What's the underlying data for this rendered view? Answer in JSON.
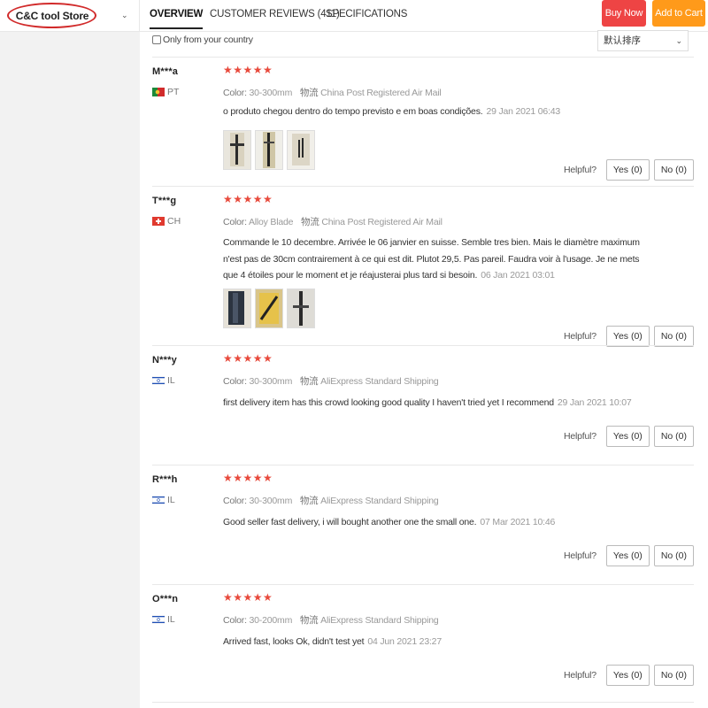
{
  "header": {
    "store_name": "C&C tool Store",
    "tabs": [
      {
        "label": "OVERVIEW",
        "active": true
      },
      {
        "label": "CUSTOMER REVIEWS (411)",
        "active": false
      },
      {
        "label": "SPECIFICATIONS",
        "active": false
      }
    ],
    "buy_now": "Buy Now",
    "add_to_cart": "Add to Cart"
  },
  "filters": {
    "only_country": "Only from your country",
    "sort_label": "默认排序"
  },
  "labels": {
    "color": "Color:",
    "shipping": "物流",
    "helpful": "Helpful?",
    "stars": "★★★★★"
  },
  "reviews": [
    {
      "user": "M***a",
      "country": "PT",
      "flag": "pt",
      "color": "30-300mm",
      "shipping": "China Post Registered Air Mail",
      "text": "o produto chegou dentro do tempo previsto e em boas condições.",
      "date": "29 Jan 2021 06:43",
      "yes": "Yes (0)",
      "no": "No (0)"
    },
    {
      "user": "T***g",
      "country": "CH",
      "flag": "ch",
      "color": "Alloy Blade",
      "shipping": "China Post Registered Air Mail",
      "text": "Commande le 10 decembre. Arrivée le 06 janvier en suisse. Semble tres bien. Mais le diamètre maximum n'est pas de 30cm contrairement à ce qui est dit. Plutot 29,5. Pas pareil. Faudra voir à l'usage. Je ne mets que 4 étoiles pour le moment et je réajusterai plus tard si besoin.",
      "date": "06 Jan 2021 03:01",
      "yes": "Yes (0)",
      "no": "No (0)"
    },
    {
      "user": "N***y",
      "country": "IL",
      "flag": "il",
      "color": "30-300mm",
      "shipping": "AliExpress Standard Shipping",
      "text": "first delivery item has this crowd looking good quality I haven't tried yet I recommend",
      "date": "29 Jan 2021 10:07",
      "yes": "Yes (0)",
      "no": "No (0)"
    },
    {
      "user": "R***h",
      "country": "IL",
      "flag": "il",
      "color": "30-300mm",
      "shipping": "AliExpress Standard Shipping",
      "text": "Good seller fast delivery, i will bought another one the small one.",
      "date": "07 Mar 2021 10:46",
      "yes": "Yes (0)",
      "no": "No (0)"
    },
    {
      "user": "O***n",
      "country": "IL",
      "flag": "il",
      "color": "30-200mm",
      "shipping": "AliExpress Standard Shipping",
      "text": "Arrived fast, looks Ok, didn't test yet",
      "date": "04 Jun 2021 23:27",
      "yes": "Yes (0)",
      "no": "No (0)"
    }
  ]
}
